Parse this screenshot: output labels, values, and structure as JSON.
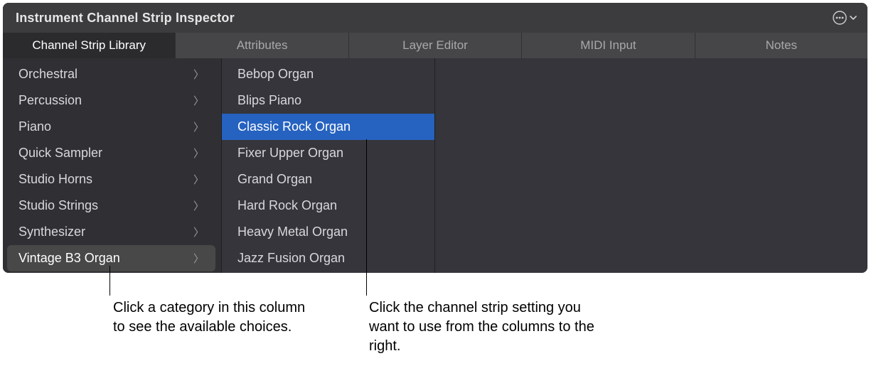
{
  "header": {
    "title": "Instrument Channel Strip Inspector"
  },
  "tabs": [
    {
      "label": "Channel Strip Library",
      "active": true
    },
    {
      "label": "Attributes",
      "active": false
    },
    {
      "label": "Layer Editor",
      "active": false
    },
    {
      "label": "MIDI Input",
      "active": false
    },
    {
      "label": "Notes",
      "active": false
    }
  ],
  "categories": [
    {
      "label": "Orchestral",
      "has_children": true,
      "selected": false
    },
    {
      "label": "Percussion",
      "has_children": true,
      "selected": false
    },
    {
      "label": "Piano",
      "has_children": true,
      "selected": false
    },
    {
      "label": "Quick Sampler",
      "has_children": true,
      "selected": false
    },
    {
      "label": "Studio Horns",
      "has_children": true,
      "selected": false
    },
    {
      "label": "Studio Strings",
      "has_children": true,
      "selected": false
    },
    {
      "label": "Synthesizer",
      "has_children": true,
      "selected": false
    },
    {
      "label": "Vintage B3 Organ",
      "has_children": true,
      "selected": true
    }
  ],
  "presets": [
    {
      "label": "Bebop Organ",
      "selected": false
    },
    {
      "label": "Blips Piano",
      "selected": false
    },
    {
      "label": "Classic Rock Organ",
      "selected": true
    },
    {
      "label": "Fixer Upper Organ",
      "selected": false
    },
    {
      "label": "Grand Organ",
      "selected": false
    },
    {
      "label": "Hard Rock Organ",
      "selected": false
    },
    {
      "label": "Heavy Metal Organ",
      "selected": false
    },
    {
      "label": "Jazz Fusion Organ",
      "selected": false
    }
  ],
  "callouts": {
    "left": "Click a category in this column to see the available choices.",
    "right": "Click the channel strip setting you want to use from the columns to the right."
  }
}
